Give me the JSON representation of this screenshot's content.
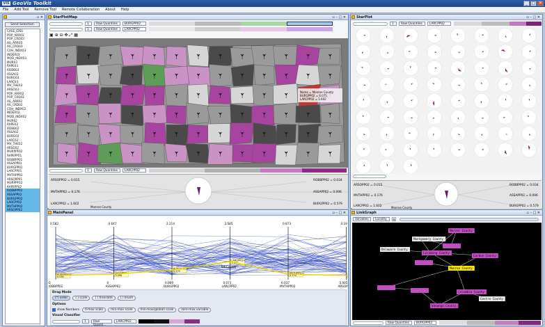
{
  "app": {
    "title": "GeoVis Toolkit",
    "logo": "VIS"
  },
  "menu": [
    "File",
    "Add Tool",
    "Remove Tool",
    "Remote Collaboration",
    "About",
    "Help"
  ],
  "window_buttons": [
    "_",
    "□",
    "✕"
  ],
  "variable_list": {
    "send_button": "Send Selection",
    "items": [
      "CASE_IDSS",
      "POP_ARR03",
      "POP_CRD03",
      "AG_ARR03",
      "AG_CRD03",
      "COH_INDX03",
      "INDEX03",
      "MOD_INDX03",
      "MUR03",
      "RAPE03",
      "ROBB03",
      "ASSA03",
      "BURG03",
      "LARC03",
      "MV_THE03",
      "ARSO03",
      "POP_ARR02",
      "POP_CRD02",
      "AG_ARR02",
      "AG_CRD02",
      "COH_INDX02",
      "INDEX02",
      "MOD_INDX02",
      "MUR02",
      "RAPE02",
      "ROBB02",
      "ASSA02",
      "BURG02",
      "LARC02",
      "MV_THE02",
      "ARSO02",
      "MURPPF02",
      "RAPEPP01",
      "ROBBPP01",
      "ASSAPP01",
      "BURGPP01",
      "LARCPP01",
      "MVTHPP01",
      "ARSOPP01",
      "MURPPF02",
      "RAPEPP02",
      "ROBBPP02",
      "ASSAPP02",
      "BURGPP02",
      "LARCPP02",
      "MVTHPP02",
      "ARSOPP02"
    ],
    "selected_from": 41
  },
  "starplotmap": {
    "title": "StarPlotMap",
    "classifier_a": "Raw Quantiles",
    "var_a": "BURGPP02",
    "classifier_b": "Raw Quantiles",
    "var_b": "LARCPP02",
    "tooltip": [
      "Name = Monroe County",
      "BURGPP02 = 6.075",
      "LARCPP02 = 1.602"
    ],
    "legend_classifier": "Raw Quantiles",
    "legend_var": "LARCPP02",
    "detail_left": [
      "ARSOPP02 = 0.015",
      "MVTHPP02 = 0.176",
      "LARCPP02 = 1.602"
    ],
    "detail_right": [
      "ROBBPP02 = 0.034",
      "ASSAPP02 = 0.096",
      "BURGPP02 = 0.579"
    ],
    "detail_county": "Monroe County",
    "colors": {
      "high": "#a6449f",
      "mid": "#c993c6",
      "low_gray": "#9a9a9a",
      "dark": "#4a4a4a",
      "green": "#5e9d58",
      "red": "#c8362e",
      "light": "#d6d6d6"
    }
  },
  "starplot": {
    "title": "StarPlot",
    "classifier": "Raw Quantiles",
    "var": "LARCPP02",
    "detail_left": [
      "ARSOPP02 = 0.015",
      "MVTHPP02 = 0.176",
      "LARCPP02 = 1.602"
    ],
    "detail_right": [
      "ROBBPP02 = 0.034",
      "ASSAPP02 = 0.096",
      "BURGPP02 = 0.579"
    ],
    "detail_county": "Monroe County"
  },
  "mainpanel": {
    "title": "MainPanel",
    "axis_tops": [
      "0.582",
      "0.647",
      "2.214",
      "2.585",
      "0.873",
      "0.19"
    ],
    "axis_labels": [
      "ROBBPP02",
      "ASSAPP02",
      "BURGPP02",
      "LARCPP02",
      "MVTHPP02",
      "ARSOPP02"
    ],
    "axis_bottoms": [
      "0",
      "0",
      "0.069",
      "0.071",
      "0.037",
      "0.005"
    ],
    "tip_labels": [
      "ROBBPP02=\n0.034",
      "ASSAPP02=\n0.096",
      "BURGPP02=\n0.579",
      "LARCPP02=\n1.602",
      "MVTHPP02=\n0.176",
      "ARSOPP02=\n0.015"
    ],
    "county_tip": "Elk County",
    "drag_mode_label": "Drag Mode",
    "drag_modes": [
      "(*) order",
      "( ) scale",
      "( ) translate",
      "( ) brush"
    ],
    "options_label": "Options",
    "show_numbers": "show Numbers",
    "option_buttons": [
      "0-max scale",
      "min-max scale",
      "min-max(global) scale",
      "zero-max variable"
    ],
    "visual_classifier_label": "Visual Classifier",
    "vc_classifier": "Raw Quanti...",
    "vc_var": "LARCPP02"
  },
  "linkgraph": {
    "title": "LinkGraph",
    "variables_btn": "Variables",
    "locality_btn": "Locality",
    "nodes": [
      {
        "label": "Montgomery County",
        "style": "gray"
      },
      {
        "label": "Delaware County",
        "style": "gray"
      },
      {
        "label": "Mercer County",
        "style": "pink"
      },
      {
        "label": "Lycoming County",
        "style": "pink"
      },
      {
        "label": "Carbon County",
        "style": "pink"
      },
      {
        "label": "Monroe County",
        "style": "yellow"
      },
      {
        "label": "Columbia County",
        "style": "pink"
      },
      {
        "label": "Centre County",
        "style": "gray"
      },
      {
        "label": "Venango County",
        "style": "pink"
      }
    ],
    "footer_classifier": "Raw Quantiles",
    "footer_var": "BURGPP02"
  }
}
